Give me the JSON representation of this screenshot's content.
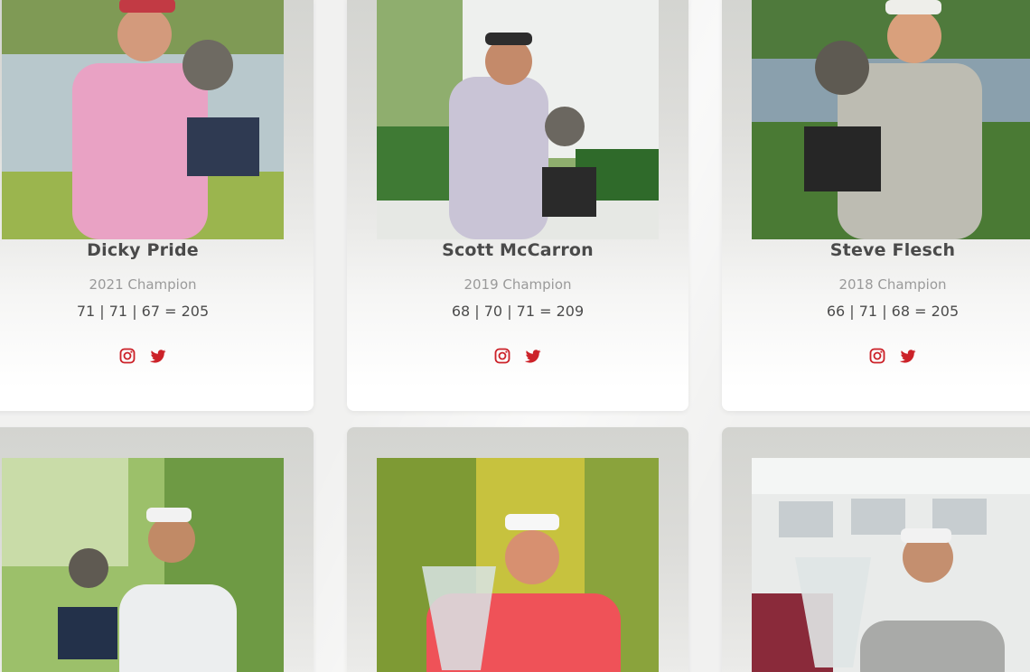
{
  "colors": {
    "accent": "#cc2229",
    "name": "#4a4a4a",
    "subtitle": "#9a9a9a",
    "score": "#4d4d4d"
  },
  "champions": [
    {
      "name": "Dicky Pride",
      "year": "2021 Champion",
      "score": "71 | 71 | 67 = 205",
      "photo_alt": "Dicky Pride holding trophy"
    },
    {
      "name": "Scott McCarron",
      "year": "2019 Champion",
      "score": "68 | 70 | 71 = 209",
      "photo_alt": "Scott McCarron holding trophy"
    },
    {
      "name": "Steve Flesch",
      "year": "2018 Champion",
      "score": "66 | 71 | 68 = 205",
      "photo_alt": "Steve Flesch holding trophy"
    },
    {
      "name": "",
      "year": "",
      "score": "",
      "photo_alt": "Champion holding trophy"
    },
    {
      "name": "",
      "year": "",
      "score": "",
      "photo_alt": "Champion holding crystal trophy"
    },
    {
      "name": "",
      "year": "",
      "score": "",
      "photo_alt": "Champion holding crystal trophy"
    }
  ],
  "icons": {
    "instagram": "instagram-icon",
    "twitter": "twitter-icon"
  }
}
